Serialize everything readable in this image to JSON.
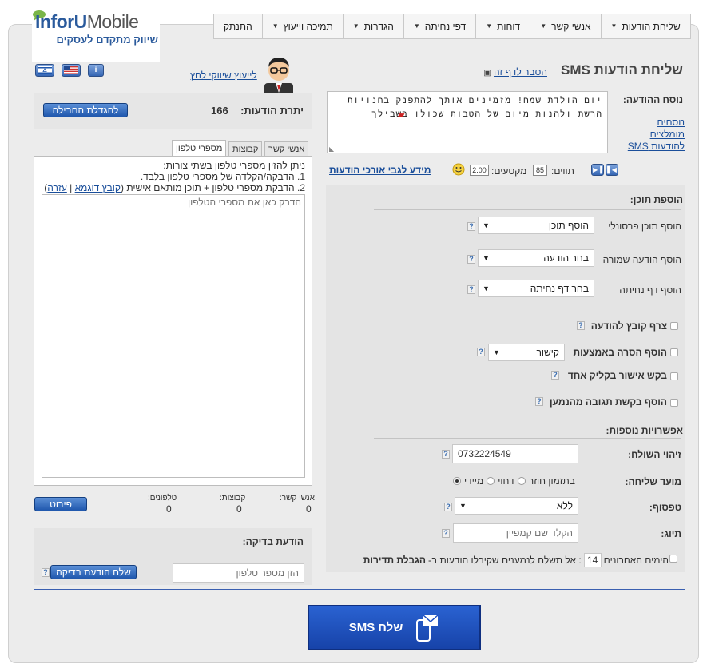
{
  "brand": {
    "name_blue": "InforU",
    "name_grey": "Mobile",
    "tagline": "שיווק מתקדם לעסקים"
  },
  "nav": [
    {
      "label": "שליחת הודעות"
    },
    {
      "label": "אנשי קשר"
    },
    {
      "label": "דוחות"
    },
    {
      "label": "דפי נחיתה"
    },
    {
      "label": "הגדרות"
    },
    {
      "label": "תמיכה וייעוץ"
    },
    {
      "label": "התנתק"
    }
  ],
  "page": {
    "title": "שליחת הודעות SMS",
    "explain_link": "הסבר לדף זה",
    "advisor_link": "לייעוץ שיווקי לחץ"
  },
  "message": {
    "label": "נוסח ההודעה:",
    "text": "יום הולדת שמח! מזמינים אותך להתפנק בחנויות הרשת ולהנות מיום של הטבות שכולו בשבילך",
    "recommended_link": "נוסחים מומלצים להודעות SMS",
    "chars_label": "תווים:",
    "chars_value": "85",
    "segments_label": "מקטעים:",
    "segments_value": "2.00",
    "long_msg_link": "מידע לגבי אורכי הודעות"
  },
  "balance": {
    "label": "יתרת הודעות:",
    "value": "166",
    "button": "להגדלת החבילה"
  },
  "recipients": {
    "tabs": [
      "אנשי קשר",
      "קבוצות",
      "מספרי טלפון"
    ],
    "intro": "ניתן להזין מספרי טלפון בשתי צורות:",
    "line1": "1. הדבקה/הקלדה של מספרי טלפון בלבד.",
    "line2": "2. הדבקת מספרי טלפון + תוכן מותאם אישית",
    "sample_link": "קובץ דוגמא",
    "help_link": "עזרה",
    "placeholder": "הדבק כאן את מספרי הטלפון"
  },
  "counts": {
    "contacts_label": "אנשי קשר:",
    "contacts": "0",
    "groups_label": "קבוצות:",
    "groups": "0",
    "phones_label": "טלפונים:",
    "phones": "0",
    "details_button": "פירוט"
  },
  "test": {
    "title": "הודעת בדיקה:",
    "placeholder": "הזן מספר טלפון",
    "button": "שלח הודעת בדיקה"
  },
  "content": {
    "title": "הוספת תוכן:",
    "personal_label": "הוסף תוכן פרסונלי",
    "personal_value": "הוסף תוכן",
    "saved_label": "הוסף הודעה שמורה",
    "saved_value": "בחר הודעה",
    "landing_label": "הוסף דף נחיתה",
    "landing_value": "בחר דף נחיתה",
    "attach_label": "צרף קובץ להודעה",
    "removal_label": "הוסף הסרה באמצעות",
    "removal_value": "קישור",
    "confirm_label": "בקש אישור בקליק אחד",
    "reply_label": "הוסף בקשת תגובה מהנמען"
  },
  "options": {
    "title": "אפשרויות נוספות:",
    "sender_label": "זיהוי השולח:",
    "sender_value": "0732224549",
    "timing_label": "מועד שליחה:",
    "timing_immediate": "מיידי",
    "timing_delayed": "דחוי",
    "timing_recurring": "בתזמון חוזר",
    "form_label": "טפסוף:",
    "form_value": "ללא",
    "tag_label": "תיוג:",
    "tag_placeholder": "הקלד שם קמפיין",
    "limit_label": "הגבלת תדירות",
    "limit_text_a": ": אל תשלח לנמענים שקיבלו הודעות ב-",
    "limit_days": "14",
    "limit_text_b": "הימים האחרונים"
  },
  "send_button": "שלח SMS",
  "colors": {
    "accent": "#1f57ad",
    "send_bg": "#1d4fc2",
    "panel": "#e4e4e4"
  }
}
